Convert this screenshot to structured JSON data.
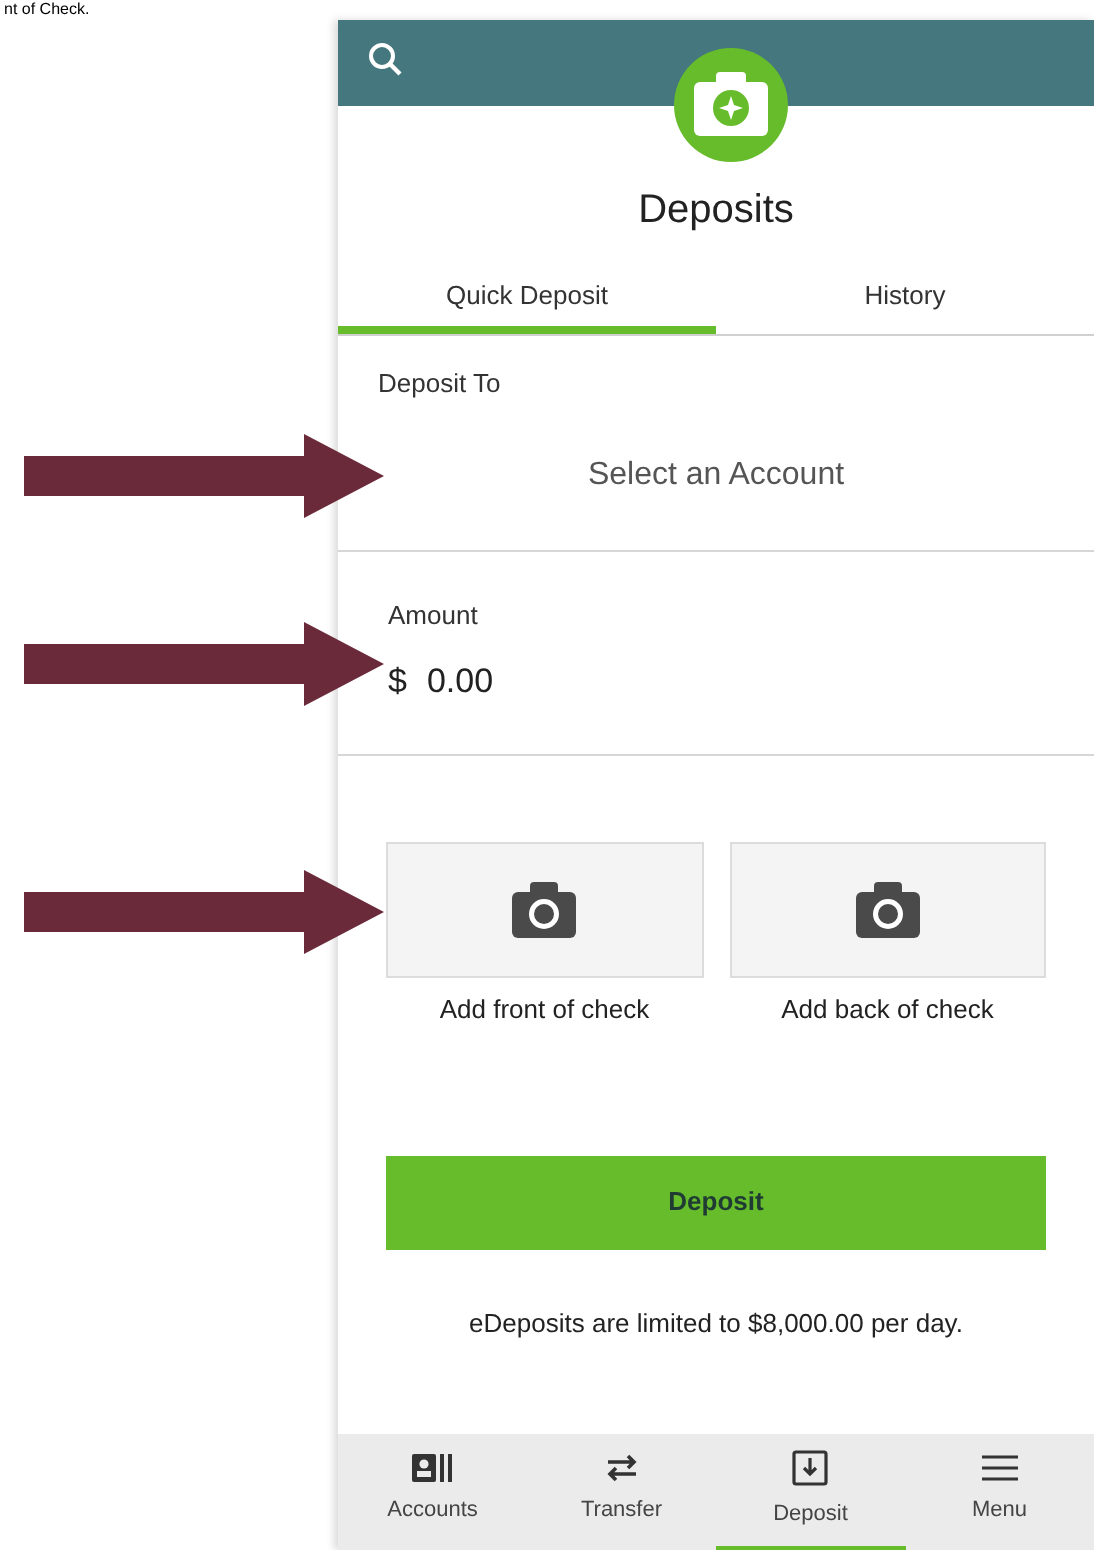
{
  "document_heading": "nt of Check.",
  "title": "Deposits",
  "tabs": [
    {
      "label": "Quick Deposit",
      "selected": true
    },
    {
      "label": "History",
      "selected": false
    }
  ],
  "deposit_to": {
    "label": "Deposit To",
    "placeholder": "Select an Account"
  },
  "amount": {
    "label": "Amount",
    "currency": "$",
    "value": "0.00"
  },
  "check_images": [
    {
      "label": "Add front of check"
    },
    {
      "label": "Add back of check"
    }
  ],
  "deposit_button": "Deposit",
  "limit_note": "eDeposits are limited to $8,000.00 per day.",
  "bottom_nav": [
    {
      "label": "Accounts",
      "selected": false
    },
    {
      "label": "Transfer",
      "selected": false
    },
    {
      "label": "Deposit",
      "selected": true
    },
    {
      "label": "Menu",
      "selected": false
    }
  ]
}
